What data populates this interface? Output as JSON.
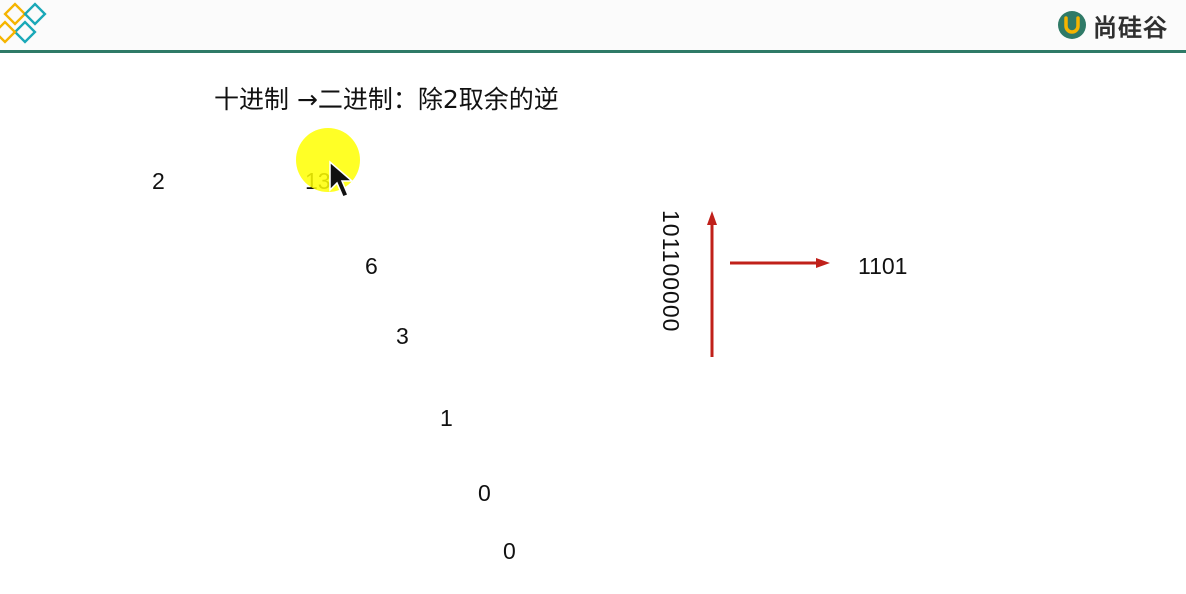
{
  "header": {
    "brand_name": "尚硅谷",
    "logo_icon": "diamond-logo-icon",
    "brand_icon": "u-logo-icon",
    "accent_color": "#2f7a67",
    "logo_colors": [
      "#f5b400",
      "#1aa8b8"
    ]
  },
  "title": "十进制 →二进制：除2取余的逆",
  "division": {
    "divisor": "2",
    "quotients": [
      "13",
      "6",
      "3",
      "1",
      "0",
      "0"
    ]
  },
  "result": {
    "vertical_binary": "101100000",
    "final_binary": "1101",
    "arrow_color": "#c0201a"
  },
  "cursor": {
    "highlight_color": "#ffff00",
    "icon": "mouse-pointer-icon"
  }
}
